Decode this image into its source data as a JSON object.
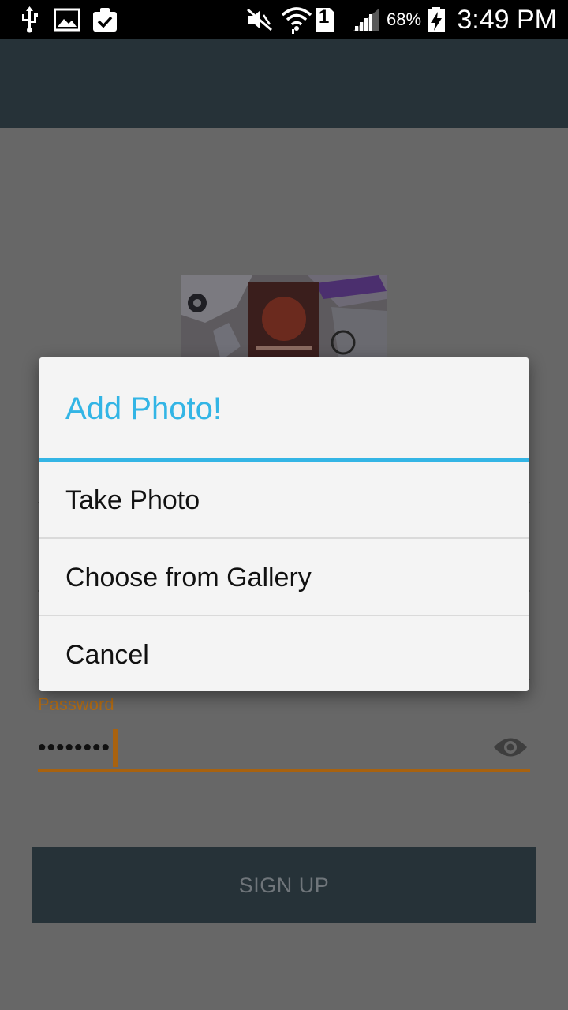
{
  "status_bar": {
    "battery_percent": "68%",
    "sim_slot": "1",
    "time": "3:49 PM",
    "icons": [
      "usb-icon",
      "image-icon",
      "clipboard-check-icon",
      "mute-icon",
      "wifi-icon",
      "sim-icon",
      "signal-icon",
      "battery-charging-icon"
    ]
  },
  "app_bar": {
    "color": "#263238"
  },
  "form": {
    "password_label": "Password",
    "password_value": "••••••••",
    "signup_label": "SIGN UP"
  },
  "dialog": {
    "title": "Add Photo!",
    "items": [
      "Take Photo",
      "Choose from Gallery",
      "Cancel"
    ],
    "accent_color": "#33b5e5"
  }
}
